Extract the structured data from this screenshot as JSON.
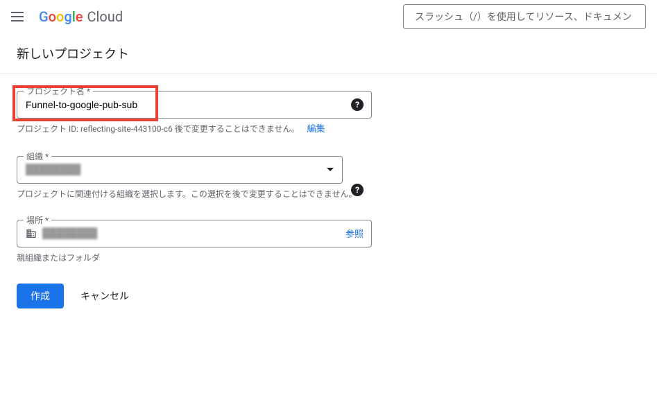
{
  "header": {
    "logo_cloud": "Cloud",
    "search_placeholder": "スラッシュ（/）を使用してリソース、ドキュメン"
  },
  "page": {
    "title": "新しいプロジェクト"
  },
  "form": {
    "project_name": {
      "label": "プロジェクト名 *",
      "value": "Funnel-to-google-pub-sub",
      "helper": "プロジェクト ID: reflecting-site-443100-c6 後で変更することはできません。",
      "edit": "編集"
    },
    "organization": {
      "label": "組織 *",
      "value": "",
      "helper": "プロジェクトに関連付ける組織を選択します。この選択を後で変更することはできません。"
    },
    "location": {
      "label": "場所 *",
      "value": "",
      "browse": "参照",
      "helper": "親組織またはフォルダ"
    }
  },
  "buttons": {
    "create": "作成",
    "cancel": "キャンセル"
  }
}
